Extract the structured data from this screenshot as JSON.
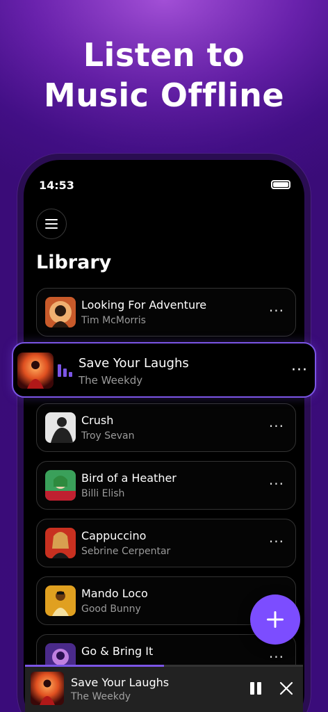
{
  "promo": {
    "headline_line1": "Listen to",
    "headline_line2": "Music Offline"
  },
  "status_bar": {
    "time": "14:53"
  },
  "library": {
    "title": "Library",
    "tracks": [
      {
        "title": "Looking For Adventure",
        "artist": "Tim McMorris",
        "art_colors": [
          "#c85a2a",
          "#f0b070"
        ]
      },
      {
        "title": "Save Your Laughs",
        "artist": "The Weekdy",
        "active": true,
        "art_colors": [
          "#8a1010",
          "#e05020"
        ]
      },
      {
        "title": "Crush",
        "artist": "Troy Sevan",
        "art_colors": [
          "#e6e6e6",
          "#222222"
        ]
      },
      {
        "title": "Bird of a Heather",
        "artist": "Billi Elish",
        "art_colors": [
          "#3aa05a",
          "#c02030"
        ]
      },
      {
        "title": "Cappuccino",
        "artist": "Sebrine Cerpentar",
        "art_colors": [
          "#c83020",
          "#e8b080"
        ]
      },
      {
        "title": "Mando Loco",
        "artist": "Good Bunny",
        "art_colors": [
          "#e0a020",
          "#6a3a10"
        ]
      },
      {
        "title": "Go & Bring It",
        "artist": "",
        "art_colors": [
          "#4a2a8a",
          "#c080e0"
        ]
      }
    ],
    "more_label": "···"
  },
  "mini_player": {
    "title": "Save Your Laughs",
    "artist": "The Weekdy",
    "progress": 0.5
  },
  "icons": {
    "menu": "hamburger-icon",
    "add": "plus-icon",
    "pause": "pause-icon",
    "close": "close-icon",
    "eq": "equalizer-icon"
  },
  "colors": {
    "accent": "#7b55e6",
    "fab": "#7c4dff",
    "background": "#3a0c78"
  }
}
